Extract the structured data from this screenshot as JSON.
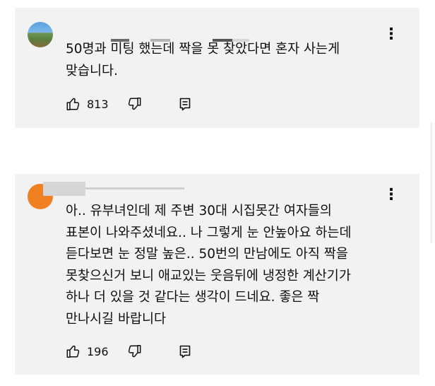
{
  "comments": [
    {
      "text": "50명과 미팅 했는데 짝을 못 찾았다면 혼자 사는게\n맞습니다.",
      "likes": "813",
      "avatar_icon": "landscape-avatar",
      "more_icon": "⋮"
    },
    {
      "text": "아.. 유부녀인데 제 주변 30대 시집못간 여자들의\n표본이 나와주셨네요.. 나 그렇게 눈 안높아요 하는데\n듣다보면 눈 정말 높은.. 50번의 만남에도 아직 짝을\n못찾으신거 보니 애교있는 웃음뒤에 냉정한 계산기가\n하나 더 있을 것 같다는 생각이 드네요. 좋은 짝\n만나시길 바랍니다",
      "likes": "196",
      "avatar_icon": "orange-avatar",
      "more_icon": "⋮"
    }
  ],
  "colors": {
    "card_bg": "#f2f2f2",
    "text": "#0f0f0f",
    "avatar_orange": "#f07f22"
  }
}
